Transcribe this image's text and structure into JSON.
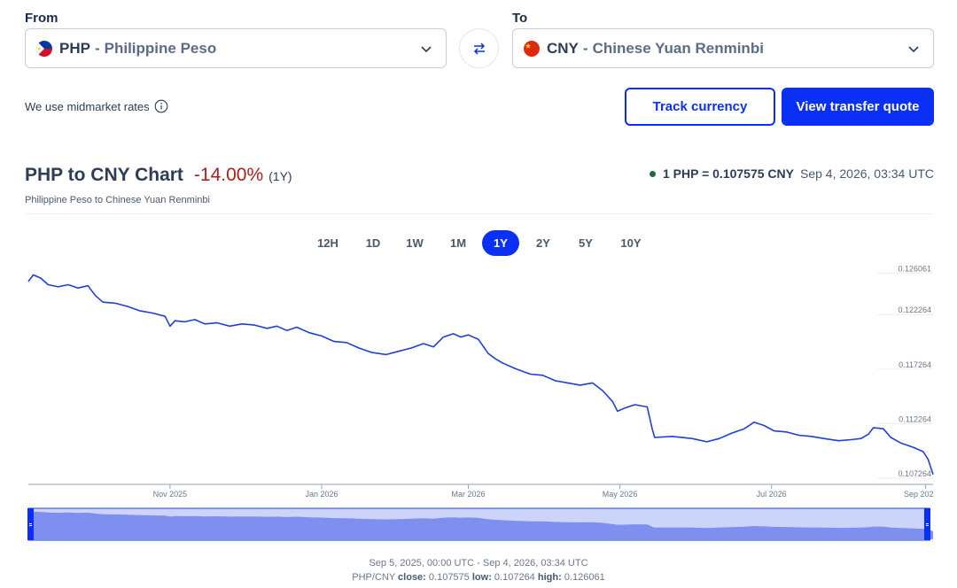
{
  "converter": {
    "from_label": "From",
    "to_label": "To",
    "from": {
      "code": "PHP",
      "separator": "-",
      "name": "Philippine Peso",
      "icon": "philippines-flag-icon"
    },
    "to": {
      "code": "CNY",
      "separator": "-",
      "name": "Chinese Yuan Renminbi",
      "icon": "china-flag-icon"
    },
    "swap_icon": "swap-arrows-icon",
    "dropdown_icon": "chevron-down-icon",
    "midmarket_text": "We use midmarket rates",
    "info_icon": "info-icon",
    "track_button": "Track currency",
    "quote_button": "View transfer quote"
  },
  "header": {
    "title": "PHP to CNY Chart",
    "change": "-14.00%",
    "change_period": "(1Y)",
    "subtitle": "Philippine Peso to Chinese Yuan Renminbi",
    "rate": "1 PHP = 0.107575 CNY",
    "rate_time": "Sep 4, 2026, 03:34 UTC"
  },
  "periods": [
    "12H",
    "1D",
    "1W",
    "1M",
    "1Y",
    "2Y",
    "5Y",
    "10Y"
  ],
  "active_period": "1Y",
  "footer": {
    "range": "Sep 5, 2025, 00:00 UTC - Sep 4, 2026, 03:34 UTC",
    "pair": "PHP/CNY",
    "close_label": "close:",
    "close": "0.107575",
    "low_label": "low:",
    "low": "0.107264",
    "high_label": "high:",
    "high": "0.126061"
  },
  "colors": {
    "accent": "#0a2ff5",
    "line": "#1f3fd6",
    "negative": "#a8221a",
    "live_dot": "#1b6b3a",
    "navigator_fill": "#7f8ff0"
  },
  "chart_data": {
    "type": "line",
    "title": "PHP to CNY Chart",
    "subtitle": "Philippine Peso to Chinese Yuan Renminbi",
    "x_ticks": [
      "Nov 2025",
      "Jan 2026",
      "Mar 2026",
      "May 2026",
      "Jul 2026",
      "Sep 202"
    ],
    "y_ticks": [
      0.126061,
      0.122264,
      0.117264,
      0.112264,
      0.107264
    ],
    "y_ticks_text": [
      "0.126061",
      "0.122264",
      "0.117264",
      "0.112264",
      "0.107264"
    ],
    "ylim": [
      0.1067,
      0.1265
    ],
    "xlim": [
      "2025-09-05",
      "2026-09-04"
    ],
    "grid": true,
    "series": [
      {
        "points": [
          [
            "2025-09-05",
            0.1253
          ],
          [
            "2025-09-07",
            0.1259
          ],
          [
            "2025-09-10",
            0.1256
          ],
          [
            "2025-09-13",
            0.125
          ],
          [
            "2025-09-17",
            0.1248
          ],
          [
            "2025-09-21",
            0.125
          ],
          [
            "2025-09-25",
            0.1247
          ],
          [
            "2025-09-29",
            0.1249
          ],
          [
            "2025-10-02",
            0.124
          ],
          [
            "2025-10-05",
            0.1234
          ],
          [
            "2025-10-10",
            0.1233
          ],
          [
            "2025-10-15",
            0.123
          ],
          [
            "2025-10-20",
            0.1226
          ],
          [
            "2025-10-25",
            0.1224
          ],
          [
            "2025-10-30",
            0.1221
          ],
          [
            "2025-11-01",
            0.1212
          ],
          [
            "2025-11-03",
            0.1217
          ],
          [
            "2025-11-07",
            0.1216
          ],
          [
            "2025-11-11",
            0.1218
          ],
          [
            "2025-11-15",
            0.1214
          ],
          [
            "2025-11-20",
            0.1215
          ],
          [
            "2025-11-25",
            0.1212
          ],
          [
            "2025-11-30",
            0.1214
          ],
          [
            "2025-12-05",
            0.1213
          ],
          [
            "2025-12-10",
            0.121
          ],
          [
            "2025-12-14",
            0.1212
          ],
          [
            "2025-12-18",
            0.1208
          ],
          [
            "2025-12-22",
            0.1211
          ],
          [
            "2025-12-27",
            0.1206
          ],
          [
            "2026-01-01",
            0.1203
          ],
          [
            "2026-01-06",
            0.1198
          ],
          [
            "2026-01-11",
            0.1197
          ],
          [
            "2026-01-16",
            0.1192
          ],
          [
            "2026-01-21",
            0.1188
          ],
          [
            "2026-01-27",
            0.1186
          ],
          [
            "2026-02-01",
            0.1189
          ],
          [
            "2026-02-06",
            0.1192
          ],
          [
            "2026-02-11",
            0.1196
          ],
          [
            "2026-02-15",
            0.1193
          ],
          [
            "2026-02-19",
            0.1202
          ],
          [
            "2026-02-23",
            0.1205
          ],
          [
            "2026-02-26",
            0.1202
          ],
          [
            "2026-03-01",
            0.1204
          ],
          [
            "2026-03-05",
            0.12
          ],
          [
            "2026-03-09",
            0.1187
          ],
          [
            "2026-03-12",
            0.1182
          ],
          [
            "2026-03-15",
            0.1178
          ],
          [
            "2026-03-20",
            0.1173
          ],
          [
            "2026-03-26",
            0.1168
          ],
          [
            "2026-03-31",
            0.1167
          ],
          [
            "2026-04-05",
            0.1162
          ],
          [
            "2026-04-10",
            0.116
          ],
          [
            "2026-04-15",
            0.1158
          ],
          [
            "2026-04-20",
            0.116
          ],
          [
            "2026-04-24",
            0.1153
          ],
          [
            "2026-04-28",
            0.1143
          ],
          [
            "2026-04-30",
            0.1134
          ],
          [
            "2026-05-03",
            0.1137
          ],
          [
            "2026-05-07",
            0.114
          ],
          [
            "2026-05-12",
            0.1138
          ],
          [
            "2026-05-14",
            0.1118
          ],
          [
            "2026-05-15",
            0.111
          ],
          [
            "2026-05-22",
            0.1111
          ],
          [
            "2026-05-30",
            0.1109
          ],
          [
            "2026-06-05",
            0.1106
          ],
          [
            "2026-06-10",
            0.1109
          ],
          [
            "2026-06-15",
            0.1114
          ],
          [
            "2026-06-20",
            0.1118
          ],
          [
            "2026-06-24",
            0.1124
          ],
          [
            "2026-06-28",
            0.1121
          ],
          [
            "2026-07-02",
            0.1116
          ],
          [
            "2026-07-07",
            0.1115
          ],
          [
            "2026-07-12",
            0.1112
          ],
          [
            "2026-07-17",
            0.1111
          ],
          [
            "2026-07-22",
            0.1109
          ],
          [
            "2026-07-28",
            0.1107
          ],
          [
            "2026-08-02",
            0.1108
          ],
          [
            "2026-08-06",
            0.1109
          ],
          [
            "2026-08-09",
            0.1113
          ],
          [
            "2026-08-11",
            0.1119
          ],
          [
            "2026-08-15",
            0.1118
          ],
          [
            "2026-08-18",
            0.111
          ],
          [
            "2026-08-22",
            0.1105
          ],
          [
            "2026-08-27",
            0.1101
          ],
          [
            "2026-08-31",
            0.1097
          ],
          [
            "2026-09-02",
            0.109
          ],
          [
            "2026-09-04",
            0.1076
          ]
        ]
      }
    ],
    "navigator": {
      "start": "2025-09-05",
      "end": "2026-09-04"
    }
  }
}
